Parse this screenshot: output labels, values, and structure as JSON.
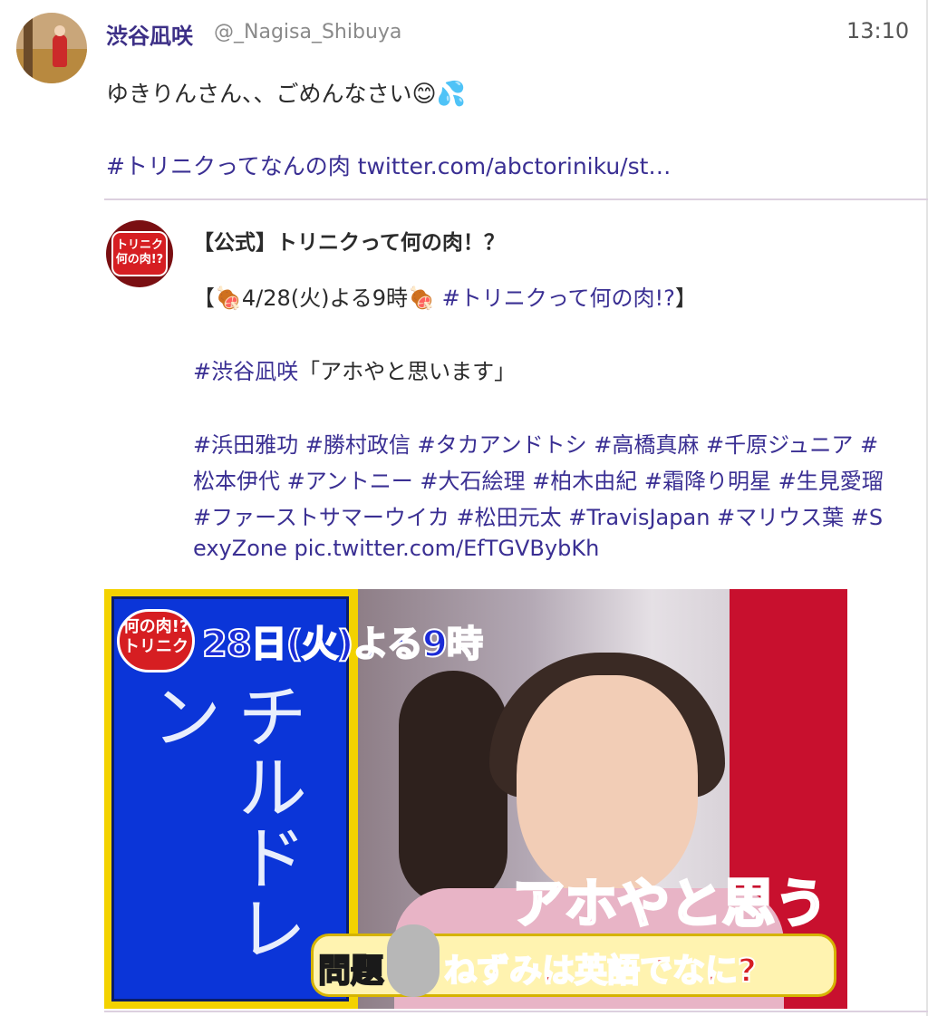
{
  "tweet": {
    "author_name": "渋谷凪咲",
    "author_handle": "@_Nagisa_Shibuya",
    "timestamp": "13:10",
    "text": "ゆきりんさん、、ごめんなさい",
    "emojis": [
      "smiling-face",
      "sweat-droplets"
    ],
    "link_text": "#トリニクってなんの肉 twitter.com/abctoriniku/st…"
  },
  "quoted_tweet": {
    "author_name": "【公式】トリニクって何の肉！？",
    "line1_prefix": "【",
    "line1_date": "4/28(火)よる9時",
    "line1_hashtag": "#トリニクって何の肉!?",
    "line1_suffix": "】",
    "line2_hashtag": "#渋谷凪咲",
    "line2_text": "「アホやと思います」",
    "hashtag_lines": [
      "#浜田雅功 #勝村政信 #タカアンドトシ #高橋真麻 #千原ジュニア #",
      "松本伊代 #アントニー #大石絵理 #柏木由紀 #霜降り明星 #生見愛瑠",
      "#ファーストサマーウイカ #松田元太 #TravisJapan #マリウス葉 #S",
      "exyZone pic.twitter.com/EfTGVBybKh"
    ],
    "avatar_text": "トリニク何の肉!?"
  },
  "media": {
    "logo_text": "何の肉!? トリニク",
    "date_banner": "28日(火)よる9時",
    "handwriting": "チルドレン",
    "caption_big": "アホやと思う",
    "caption_label": "問題",
    "caption_question": "ねずみは英語でなに?"
  },
  "colors": {
    "link": "#3a2f93",
    "author": "#3c2f86",
    "divider": "#dcd0df"
  }
}
